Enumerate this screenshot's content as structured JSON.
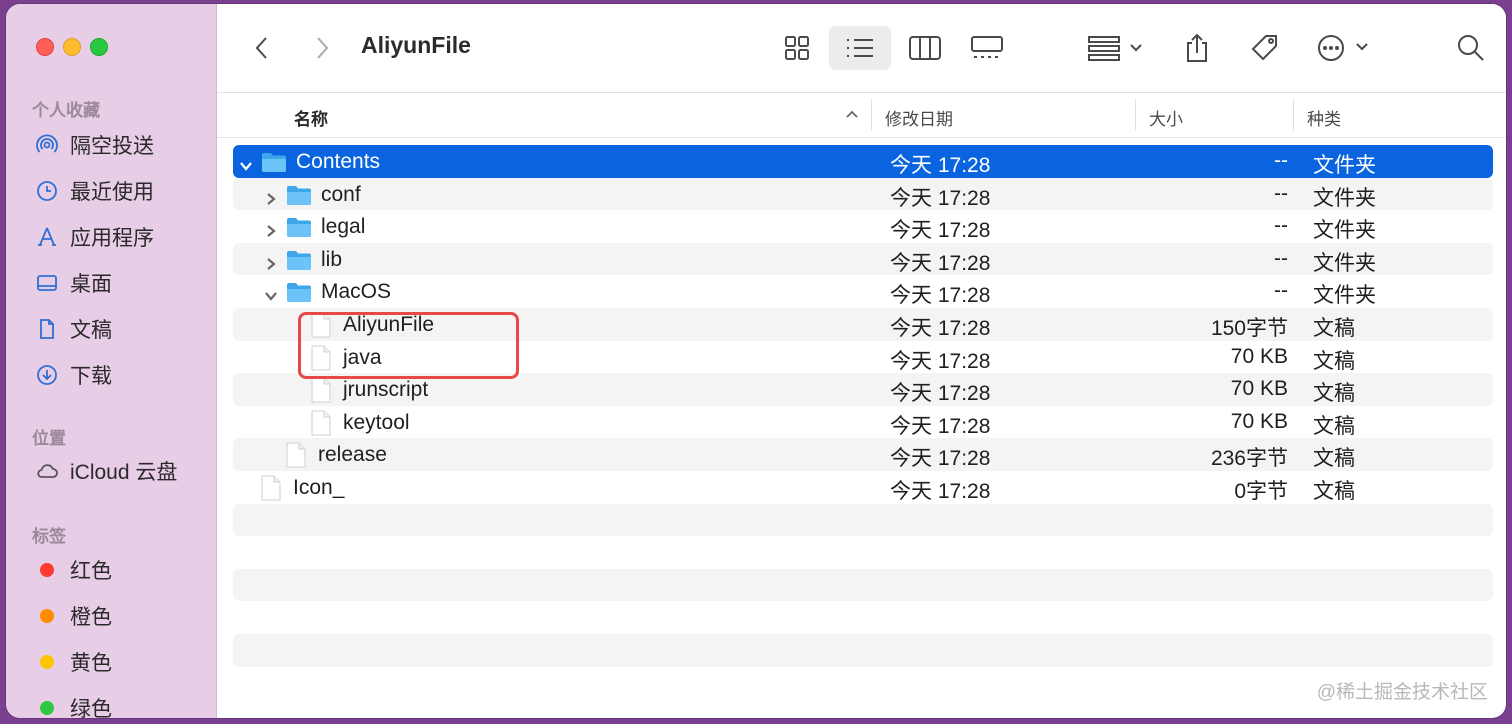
{
  "window": {
    "title": "AliyunFile"
  },
  "sidebar": {
    "favorites_heading": "个人收藏",
    "favorites": [
      {
        "label": "隔空投送",
        "icon": "airdrop-icon"
      },
      {
        "label": "最近使用",
        "icon": "clock-icon"
      },
      {
        "label": "应用程序",
        "icon": "applications-icon"
      },
      {
        "label": "桌面",
        "icon": "desktop-icon"
      },
      {
        "label": "文稿",
        "icon": "document-icon"
      },
      {
        "label": "下载",
        "icon": "download-icon"
      }
    ],
    "locations_heading": "位置",
    "locations": [
      {
        "label": "iCloud 云盘",
        "icon": "cloud-icon"
      }
    ],
    "tags_heading": "标签",
    "tags": [
      {
        "label": "红色",
        "color": "#fe3b30"
      },
      {
        "label": "橙色",
        "color": "#fe8a00"
      },
      {
        "label": "黄色",
        "color": "#fec600"
      },
      {
        "label": "绿色",
        "color": "#2dc840"
      }
    ]
  },
  "columns": {
    "name": "名称",
    "date": "修改日期",
    "size": "大小",
    "kind": "种类"
  },
  "rows": [
    {
      "name": "Contents",
      "date": "今天 17:28",
      "size": "--",
      "kind": "文件夹",
      "type": "folder",
      "level": 0,
      "expanded": true,
      "selected": true
    },
    {
      "name": "conf",
      "date": "今天 17:28",
      "size": "--",
      "kind": "文件夹",
      "type": "folder",
      "level": 1,
      "expanded": false
    },
    {
      "name": "legal",
      "date": "今天 17:28",
      "size": "--",
      "kind": "文件夹",
      "type": "folder",
      "level": 1,
      "expanded": false
    },
    {
      "name": "lib",
      "date": "今天 17:28",
      "size": "--",
      "kind": "文件夹",
      "type": "folder",
      "level": 1,
      "expanded": false
    },
    {
      "name": "MacOS",
      "date": "今天 17:28",
      "size": "--",
      "kind": "文件夹",
      "type": "folder",
      "level": 1,
      "expanded": true
    },
    {
      "name": "AliyunFile",
      "date": "今天 17:28",
      "size": "150字节",
      "kind": "文稿",
      "type": "file",
      "level": 2
    },
    {
      "name": "java",
      "date": "今天 17:28",
      "size": "70 KB",
      "kind": "文稿",
      "type": "file",
      "level": 2
    },
    {
      "name": "jrunscript",
      "date": "今天 17:28",
      "size": "70 KB",
      "kind": "文稿",
      "type": "file",
      "level": 2
    },
    {
      "name": "keytool",
      "date": "今天 17:28",
      "size": "70 KB",
      "kind": "文稿",
      "type": "file",
      "level": 2
    },
    {
      "name": "release",
      "date": "今天 17:28",
      "size": "236字节",
      "kind": "文稿",
      "type": "file",
      "level": 1
    },
    {
      "name": "Icon_",
      "date": "今天 17:28",
      "size": "0字节",
      "kind": "文稿",
      "type": "file",
      "level": 0
    }
  ],
  "watermark": "@稀土掘金技术社区",
  "colors": {
    "selection": "#0a64e0",
    "folder": "#5ab4f0",
    "highlight": "#e84848"
  }
}
